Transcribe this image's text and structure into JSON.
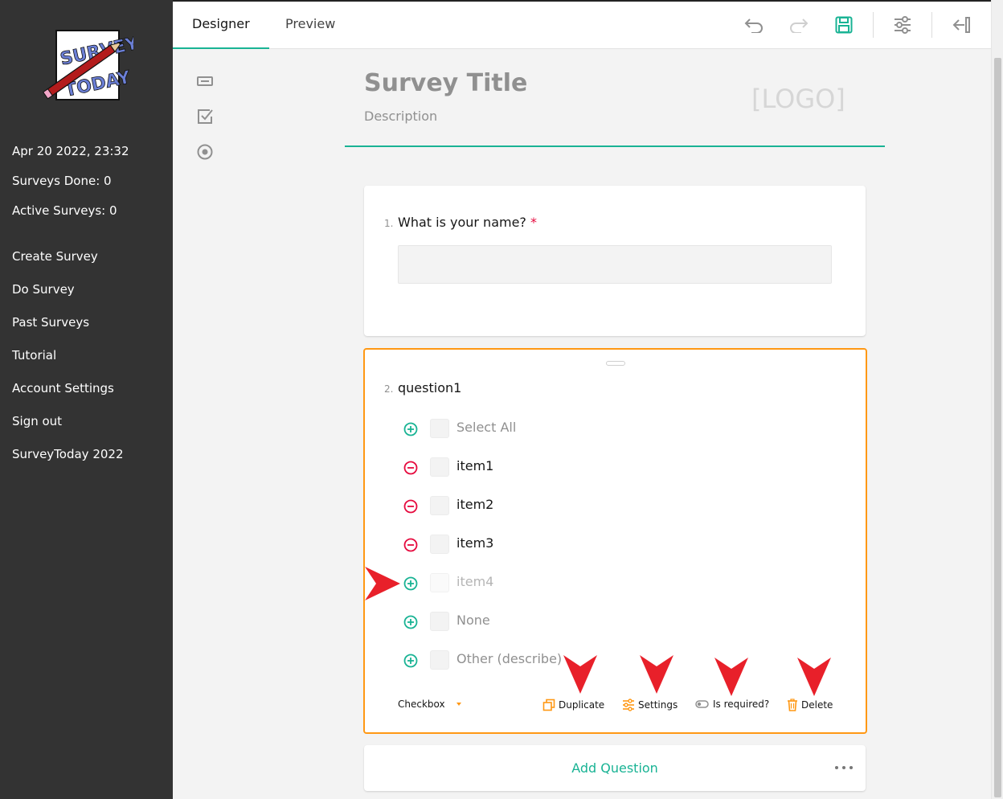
{
  "sidebar": {
    "logo_text_top": "SURVEY",
    "logo_text_bottom": "TODAY",
    "datetime": "Apr 20 2022, 23:32",
    "surveys_done": "Surveys Done: 0",
    "active_surveys": "Active Surveys: 0",
    "nav": [
      "Create Survey",
      "Do Survey",
      "Past Surveys",
      "Tutorial",
      "Account Settings",
      "Sign out"
    ],
    "footer": "SurveyToday 2022"
  },
  "tabs": {
    "designer": "Designer",
    "preview": "Preview"
  },
  "toolbar_icons": [
    "undo-icon",
    "redo-icon",
    "save-icon",
    "settings-sliders-icon",
    "collapse-panel-icon"
  ],
  "toolbox_icons": [
    "single-input-icon",
    "checkbox-icon",
    "radio-icon"
  ],
  "survey": {
    "title": "Survey Title",
    "description": "Description",
    "logo_placeholder": "[LOGO]"
  },
  "question1": {
    "number": "1.",
    "title": "What is your name?",
    "required_mark": "*"
  },
  "question2": {
    "number": "2.",
    "title": "question1",
    "choices": [
      {
        "label": "Select All",
        "action": "add"
      },
      {
        "label": "item1",
        "action": "remove"
      },
      {
        "label": "item2",
        "action": "remove"
      },
      {
        "label": "item3",
        "action": "remove"
      },
      {
        "label": "item4",
        "action": "add"
      },
      {
        "label": "None",
        "action": "add"
      },
      {
        "label": "Other (describe)",
        "action": "add"
      }
    ],
    "type_label": "Checkbox",
    "actions": {
      "duplicate": "Duplicate",
      "settings": "Settings",
      "required": "Is required?",
      "delete": "Delete"
    }
  },
  "add_question": "Add Question",
  "colors": {
    "accent": "#19b394",
    "selected_border": "#ff9814",
    "remove": "#e60a3e",
    "annotation_arrow": "#e8202a",
    "sidebar_bg": "#333333"
  }
}
